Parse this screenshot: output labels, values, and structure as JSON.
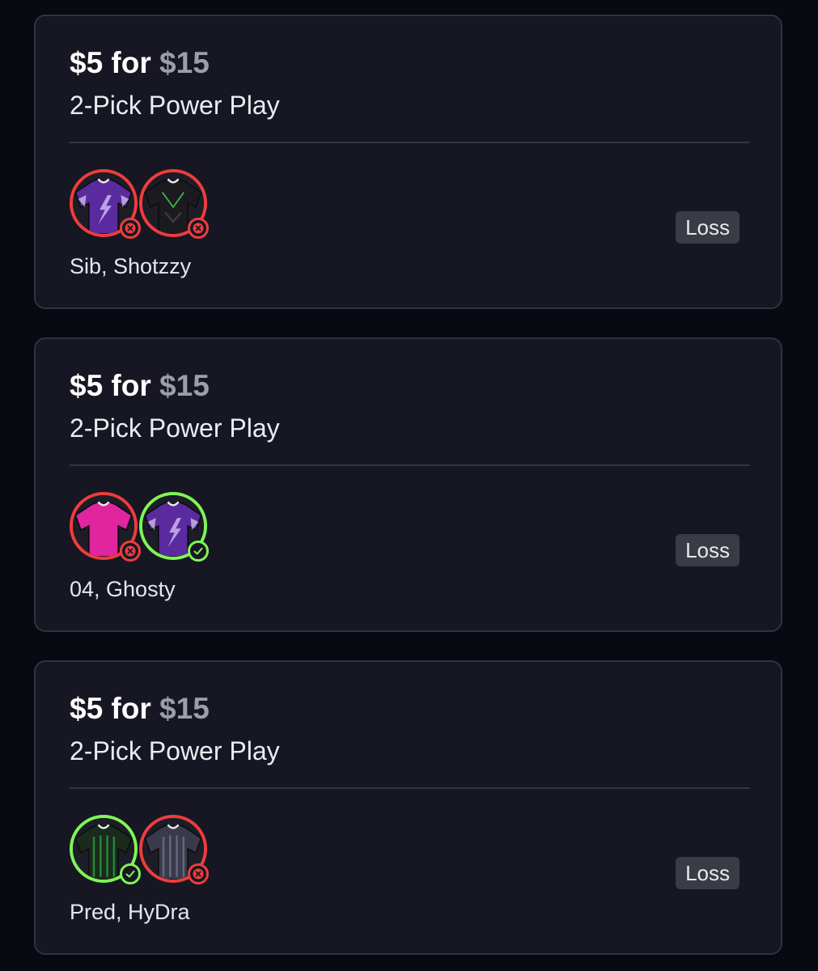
{
  "entries": [
    {
      "wager": "$5 for",
      "payout": "$15",
      "play_type": "2-Pick Power Play",
      "picks": [
        {
          "jersey_icon": "purple-jersey-icon",
          "jersey_color": "#5b2a9e",
          "result": "miss"
        },
        {
          "jersey_icon": "black-jersey-icon",
          "jersey_color": "#1b1b1f",
          "result": "miss"
        }
      ],
      "players": "Sib, Shotzzy",
      "result": "Loss"
    },
    {
      "wager": "$5 for",
      "payout": "$15",
      "play_type": "2-Pick Power Play",
      "picks": [
        {
          "jersey_icon": "pink-jersey-icon",
          "jersey_color": "#e0259f",
          "result": "miss"
        },
        {
          "jersey_icon": "purple-jersey-icon",
          "jersey_color": "#5b2a9e",
          "result": "hit"
        }
      ],
      "players": "04, Ghosty",
      "result": "Loss"
    },
    {
      "wager": "$5 for",
      "payout": "$15",
      "play_type": "2-Pick Power Play",
      "picks": [
        {
          "jersey_icon": "green-striped-jersey-icon",
          "jersey_color": "#1a2a1c",
          "result": "hit"
        },
        {
          "jersey_icon": "gray-striped-jersey-icon",
          "jersey_color": "#3a3a4c",
          "result": "miss"
        }
      ],
      "players": "Pred, HyDra",
      "result": "Loss"
    }
  ],
  "colors": {
    "background": "#080a12",
    "card": "#161722",
    "hit": "#7ff557",
    "miss": "#ee3d3d",
    "payout_text": "#9c9ea8",
    "badge": "#3a3b45"
  }
}
